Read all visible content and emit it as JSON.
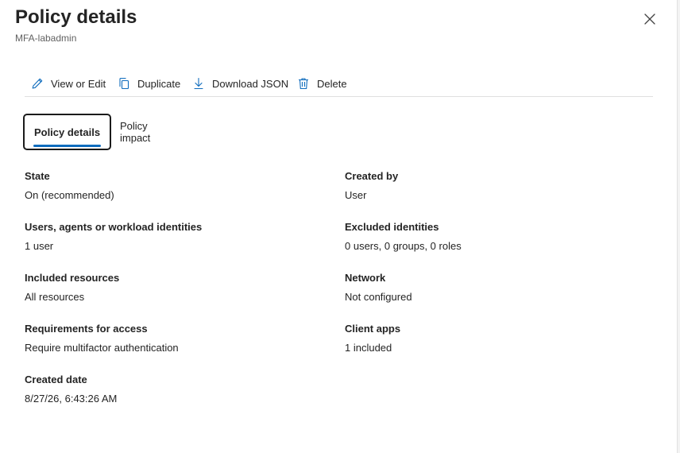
{
  "header": {
    "title": "Policy details",
    "subtitle": "MFA-labadmin"
  },
  "toolbar": {
    "view_edit": "View or Edit",
    "duplicate": "Duplicate",
    "download_json": "Download JSON",
    "delete": "Delete"
  },
  "tabs": {
    "details": "Policy details",
    "impact": "Policy impact"
  },
  "fields": {
    "state": {
      "label": "State",
      "value": "On (recommended)"
    },
    "created_by": {
      "label": "Created by",
      "value": "User"
    },
    "users": {
      "label": "Users, agents or workload identities",
      "value": "1 user"
    },
    "excluded": {
      "label": "Excluded identities",
      "value": "0 users, 0 groups, 0 roles"
    },
    "resources": {
      "label": "Included resources",
      "value": "All resources"
    },
    "network": {
      "label": "Network",
      "value": "Not configured"
    },
    "requirements": {
      "label": "Requirements for access",
      "value": "Require multifactor authentication"
    },
    "client_apps": {
      "label": "Client apps",
      "value": "1 included"
    },
    "created_date": {
      "label": "Created date",
      "value": "8/27/26, 6:43:26 AM"
    }
  },
  "icons": {
    "close": "close-icon",
    "edit": "pencil-icon",
    "duplicate": "copy-icon",
    "download": "download-icon",
    "delete": "trash-icon"
  },
  "colors": {
    "accent": "#0f6cbd",
    "text": "#242424",
    "muted": "#616161"
  }
}
